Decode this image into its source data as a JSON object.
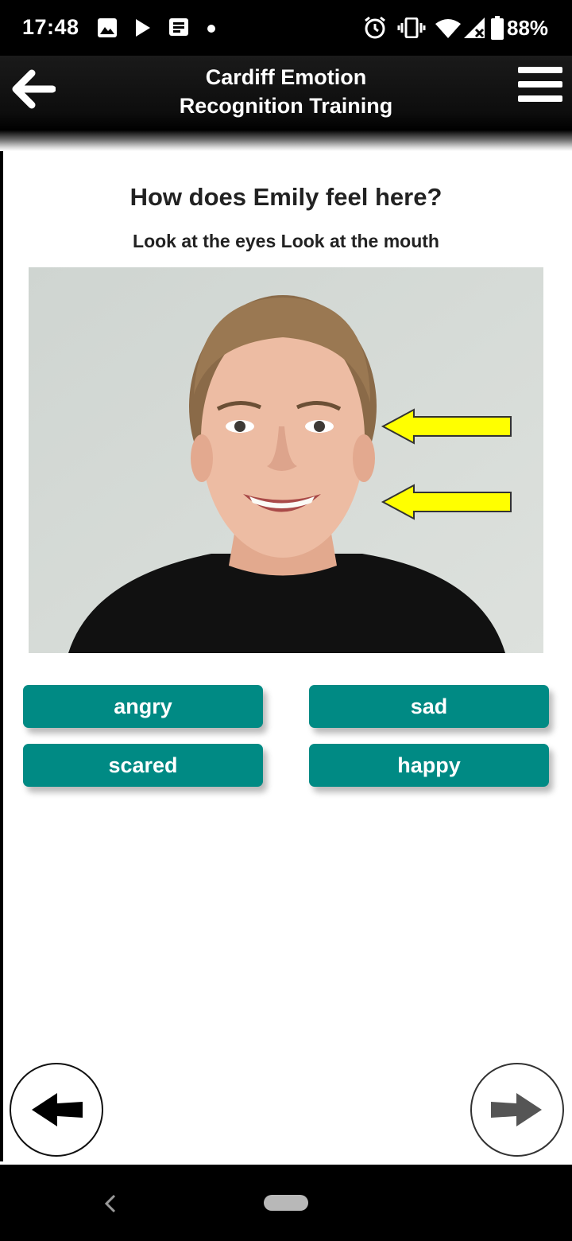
{
  "status_bar": {
    "time": "17:48",
    "battery": "88%",
    "icons": [
      "image-icon",
      "play-icon",
      "message-icon",
      "dot-icon",
      "alarm-icon",
      "vibrate-icon",
      "wifi-icon",
      "signal-icon",
      "battery-icon"
    ]
  },
  "header": {
    "title_line1": "Cardiff Emotion",
    "title_line2": "Recognition Training"
  },
  "question": {
    "text": "How does Emily feel here?",
    "hint": "Look at the eyes Look at the mouth"
  },
  "answers": [
    "angry",
    "sad",
    "scared",
    "happy"
  ],
  "colors": {
    "answer_button": "#008a84",
    "arrow_highlight": "#ffff00"
  }
}
